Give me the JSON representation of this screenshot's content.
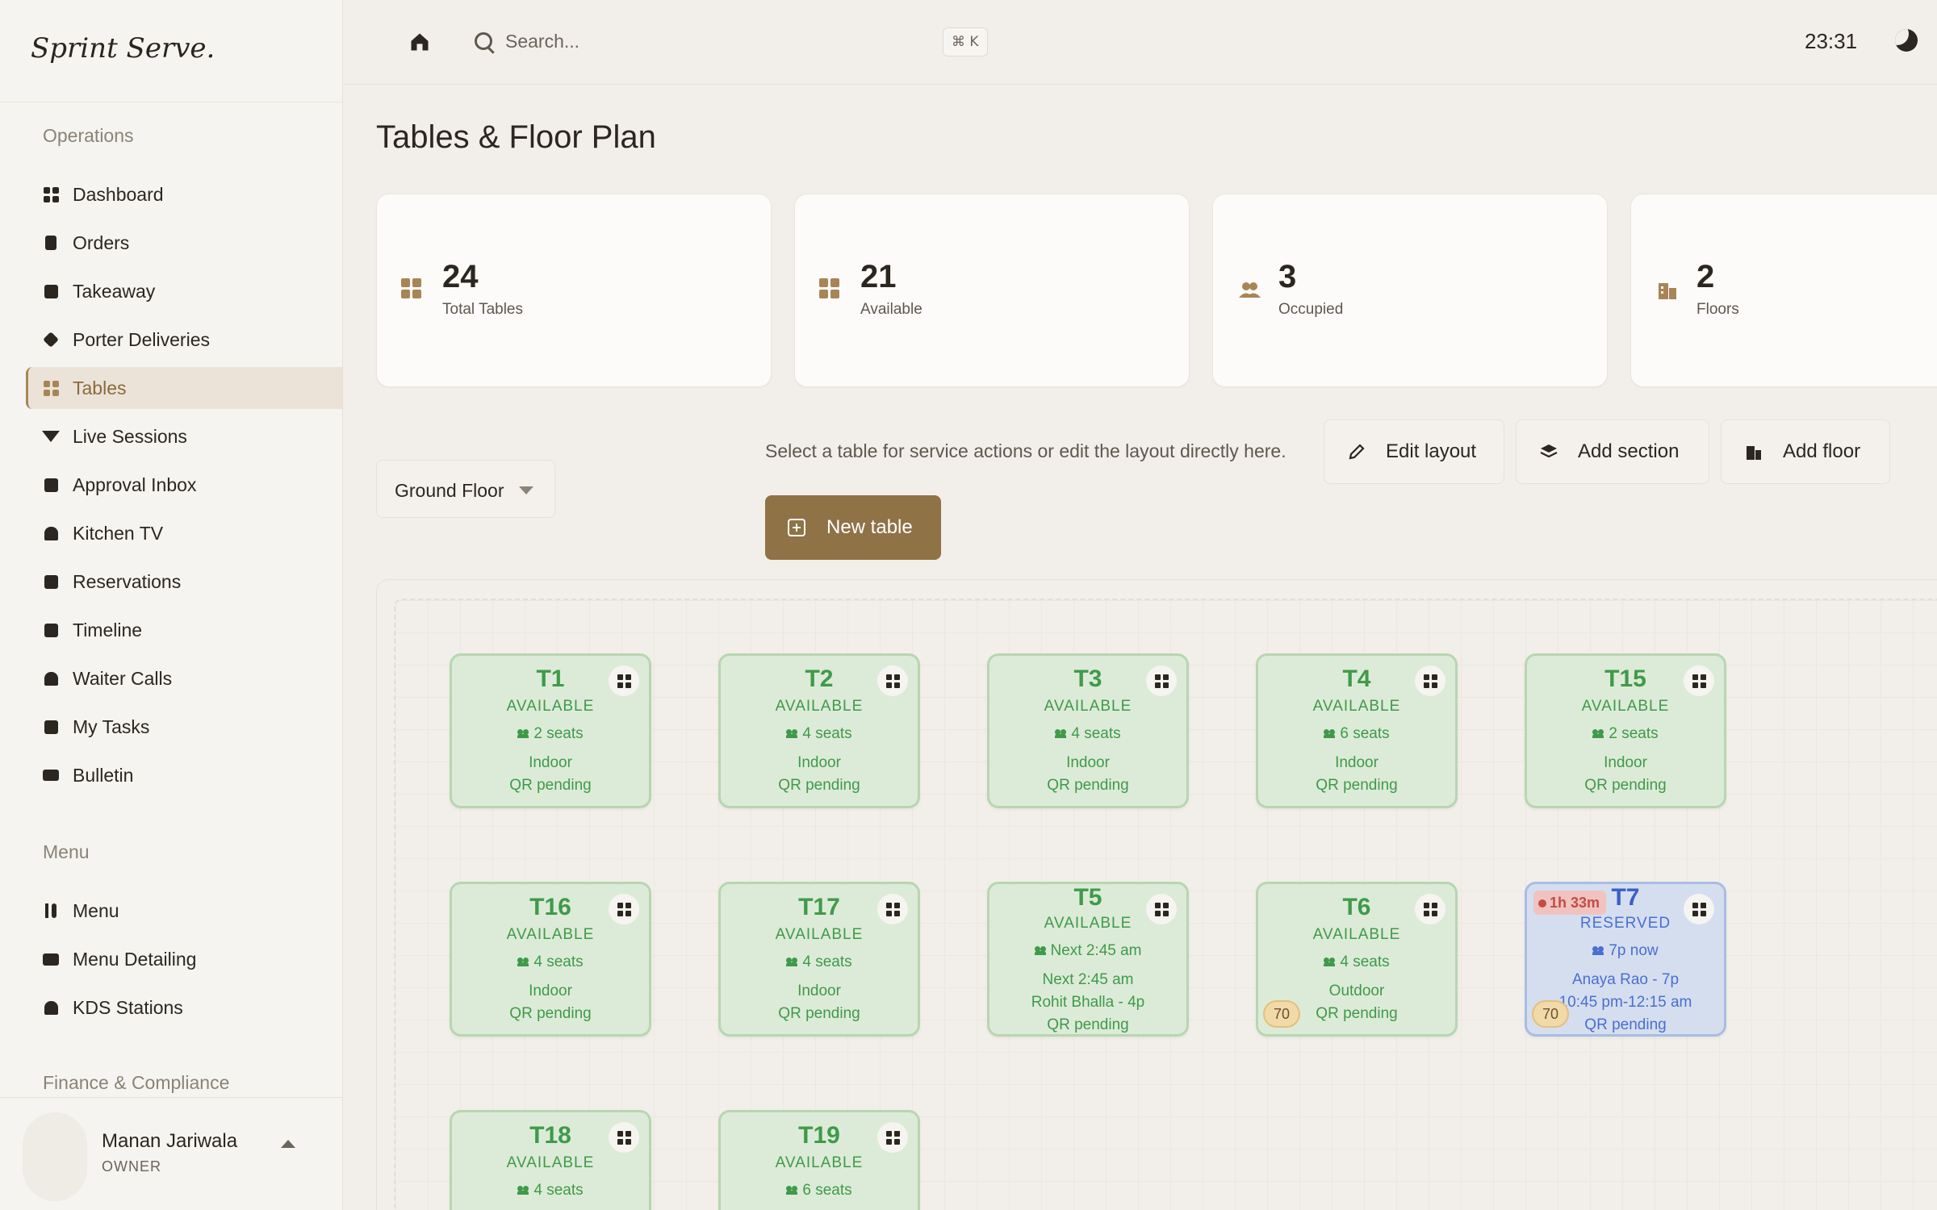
{
  "app": {
    "brand": "Sprint Serve."
  },
  "sidebar": {
    "sections": [
      "Operations",
      "Menu",
      "Finance & Compliance"
    ],
    "items": [
      {
        "label": "Dashboard",
        "icon": "dashboard-icon"
      },
      {
        "label": "Orders",
        "icon": "orders-icon"
      },
      {
        "label": "Takeaway",
        "icon": "takeaway-icon"
      },
      {
        "label": "Porter Deliveries",
        "icon": "box-icon"
      },
      {
        "label": "Tables",
        "icon": "tables-icon",
        "active": true
      },
      {
        "label": "Live Sessions",
        "icon": "wifi-icon"
      },
      {
        "label": "Approval Inbox",
        "icon": "inbox-icon"
      },
      {
        "label": "Kitchen TV",
        "icon": "chef-hat-icon"
      },
      {
        "label": "Reservations",
        "icon": "calendar-icon"
      },
      {
        "label": "Timeline",
        "icon": "calendar-icon"
      },
      {
        "label": "Waiter Calls",
        "icon": "bell-icon"
      },
      {
        "label": "My Tasks",
        "icon": "checkbox-icon"
      },
      {
        "label": "Bulletin",
        "icon": "newspaper-icon"
      },
      {
        "label": "Menu",
        "icon": "utensils-icon"
      },
      {
        "label": "Menu Detailing",
        "icon": "book-icon"
      },
      {
        "label": "KDS Stations",
        "icon": "chef-hat-icon"
      }
    ],
    "user": {
      "name": "Manan Jariwala",
      "role": "OWNER"
    }
  },
  "topbar": {
    "search_placeholder": "Search...",
    "shortcut": "⌘ K",
    "time": "23:31"
  },
  "page": {
    "title": "Tables & Floor Plan"
  },
  "stats": [
    {
      "value": "24",
      "label": "Total Tables"
    },
    {
      "value": "21",
      "label": "Available"
    },
    {
      "value": "3",
      "label": "Occupied"
    },
    {
      "value": "2",
      "label": "Floors"
    }
  ],
  "controls": {
    "floor": "Ground Floor",
    "hint": "Select a table for service actions or edit the layout directly here.",
    "edit_layout": "Edit layout",
    "add_section": "Add section",
    "add_floor": "Add floor",
    "new_table": "New table"
  },
  "tables": [
    {
      "id": "T1",
      "status": "AVAILABLE",
      "seats": "2 seats",
      "line1": "Indoor",
      "line2": "QR pending"
    },
    {
      "id": "T2",
      "status": "AVAILABLE",
      "seats": "4 seats",
      "line1": "Indoor",
      "line2": "QR pending"
    },
    {
      "id": "T3",
      "status": "AVAILABLE",
      "seats": "4 seats",
      "line1": "Indoor",
      "line2": "QR pending"
    },
    {
      "id": "T4",
      "status": "AVAILABLE",
      "seats": "6 seats",
      "line1": "Indoor",
      "line2": "QR pending"
    },
    {
      "id": "T15",
      "status": "AVAILABLE",
      "seats": "2 seats",
      "line1": "Indoor",
      "line2": "QR pending"
    },
    {
      "id": "T16",
      "status": "AVAILABLE",
      "seats": "4 seats",
      "line1": "Indoor",
      "line2": "QR pending"
    },
    {
      "id": "T17",
      "status": "AVAILABLE",
      "seats": "4 seats",
      "line1": "Indoor",
      "line2": "QR pending"
    },
    {
      "id": "T5",
      "status": "AVAILABLE",
      "seats": "Next 2:45 am",
      "line1": "Next 2:45 am",
      "line1b": "Rohit Bhalla - 4p",
      "line2": "QR pending"
    },
    {
      "id": "T6",
      "status": "AVAILABLE",
      "seats": "4 seats",
      "line1": "Outdoor",
      "line2": "QR pending",
      "badge": "70"
    },
    {
      "id": "T7",
      "status": "RESERVED",
      "seats": "7p now",
      "line1": "Anaya Rao - 7p",
      "line1b": "10:45 pm-12:15 am",
      "line2": "QR pending",
      "badge": "70",
      "timer": "1h 33m"
    },
    {
      "id": "T18",
      "status": "AVAILABLE",
      "seats": "4 seats"
    },
    {
      "id": "T19",
      "status": "AVAILABLE",
      "seats": "6 seats"
    }
  ]
}
